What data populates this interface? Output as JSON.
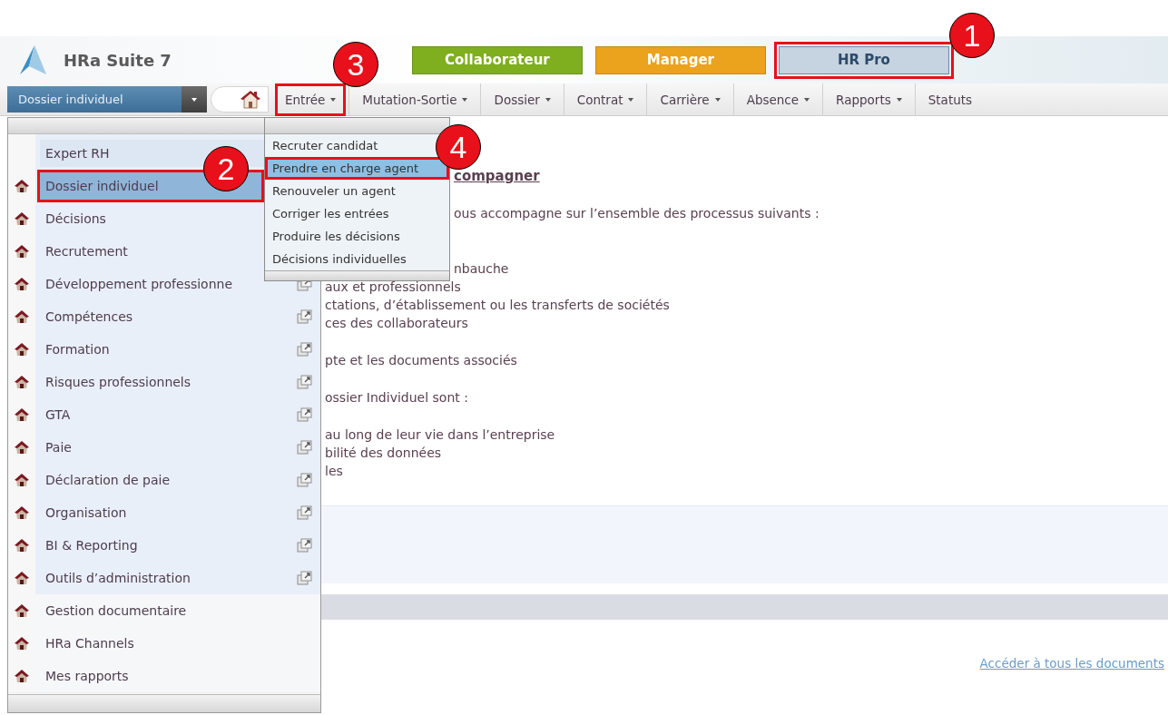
{
  "app": {
    "name": "HRa Suite 7"
  },
  "role_tabs": [
    {
      "label": "Collaborateur",
      "selected": false,
      "color": "#7fae1e",
      "highlighted": false
    },
    {
      "label": "Manager",
      "selected": false,
      "color": "#eba21c",
      "highlighted": false
    },
    {
      "label": "HR Pro",
      "selected": true,
      "color": "#c6d3e0",
      "highlighted": true
    }
  ],
  "module_select": {
    "value": "Dossier individuel"
  },
  "nav_menu": [
    {
      "label": "Entrée",
      "caret": true,
      "highlighted": true
    },
    {
      "label": "Mutation-Sortie",
      "caret": true,
      "highlighted": false
    },
    {
      "label": "Dossier",
      "caret": true,
      "highlighted": false
    },
    {
      "label": "Contrat",
      "caret": true,
      "highlighted": false
    },
    {
      "label": "Carrière",
      "caret": true,
      "highlighted": false
    },
    {
      "label": "Absence",
      "caret": true,
      "highlighted": false
    },
    {
      "label": "Rapports",
      "caret": true,
      "highlighted": false
    },
    {
      "label": "Statuts",
      "caret": false,
      "highlighted": false
    }
  ],
  "module_menu": {
    "sections": [
      {
        "kind": "primary",
        "items": [
          {
            "kind": "header",
            "label": "Expert RH",
            "selected": false,
            "highlighted": false,
            "external": false
          },
          {
            "kind": "item",
            "label": "Dossier individuel",
            "selected": true,
            "highlighted": true,
            "external": false
          },
          {
            "kind": "item",
            "label": "Décisions",
            "selected": false,
            "highlighted": false,
            "external": false
          },
          {
            "kind": "item",
            "label": "Recrutement",
            "selected": false,
            "highlighted": false,
            "external": false
          },
          {
            "kind": "item",
            "label": "Développement professionne",
            "selected": false,
            "highlighted": false,
            "external": true
          },
          {
            "kind": "item",
            "label": "Compétences",
            "selected": false,
            "highlighted": false,
            "external": true
          },
          {
            "kind": "item",
            "label": "Formation",
            "selected": false,
            "highlighted": false,
            "external": true
          },
          {
            "kind": "item",
            "label": "Risques professionnels",
            "selected": false,
            "highlighted": false,
            "external": true
          },
          {
            "kind": "item",
            "label": "GTA",
            "selected": false,
            "highlighted": false,
            "external": true
          },
          {
            "kind": "item",
            "label": "Paie",
            "selected": false,
            "highlighted": false,
            "external": true
          },
          {
            "kind": "item",
            "label": "Déclaration de paie",
            "selected": false,
            "highlighted": false,
            "external": true
          },
          {
            "kind": "item",
            "label": "Organisation",
            "selected": false,
            "highlighted": false,
            "external": true
          },
          {
            "kind": "item",
            "label": "BI & Reporting",
            "selected": false,
            "highlighted": false,
            "external": true
          },
          {
            "kind": "item",
            "label": "Outils d’administration",
            "selected": false,
            "highlighted": false,
            "external": true
          }
        ]
      },
      {
        "kind": "secondary",
        "items": [
          {
            "kind": "item",
            "label": "Gestion documentaire",
            "selected": false,
            "highlighted": false,
            "external": false
          },
          {
            "kind": "item",
            "label": "HRa Channels",
            "selected": false,
            "highlighted": false,
            "external": false
          },
          {
            "kind": "item",
            "label": "Mes rapports",
            "selected": false,
            "highlighted": false,
            "external": false
          }
        ]
      }
    ]
  },
  "entree_menu": [
    {
      "label": "Recruter candidat",
      "selected": false,
      "highlighted": false
    },
    {
      "label": "Prendre en charge agent",
      "selected": true,
      "highlighted": true
    },
    {
      "label": "Renouveler un agent",
      "selected": false,
      "highlighted": false
    },
    {
      "label": "Corriger les entrées",
      "selected": false,
      "highlighted": false
    },
    {
      "label": "Produire les décisions",
      "selected": false,
      "highlighted": false
    },
    {
      "label": "Décisions individuelles",
      "selected": false,
      "highlighted": false
    }
  ],
  "content": {
    "paragraphs": [
      {
        "kind": "heading",
        "lines": [
          {
            "text": "compagner",
            "beside_menu": true
          }
        ]
      },
      {
        "kind": "text",
        "lines": [
          {
            "text": "ous accompagne sur l’ensemble des processus suivants :",
            "beside_menu": true
          }
        ]
      },
      {
        "kind": "list",
        "lines": [
          {
            "text": "nbauche",
            "beside_menu": true
          },
          {
            "text": "aux et professionnels"
          },
          {
            "text": "ctations, d’établissement ou les transferts de sociétés"
          },
          {
            "text": "ces des collaborateurs"
          }
        ]
      },
      {
        "kind": "text",
        "lines": [
          {
            "text": "pte et les documents associés"
          }
        ]
      },
      {
        "kind": "text",
        "lines": [
          {
            "text": "ossier Individuel  sont :"
          }
        ]
      },
      {
        "kind": "list",
        "lines": [
          {
            "text": "au long de leur vie dans l’entreprise"
          },
          {
            "text": "bilité des données"
          },
          {
            "text": "les"
          }
        ]
      }
    ],
    "documents_link": "Accéder à tous les documents"
  },
  "callouts": [
    "1",
    "2",
    "3",
    "4"
  ]
}
